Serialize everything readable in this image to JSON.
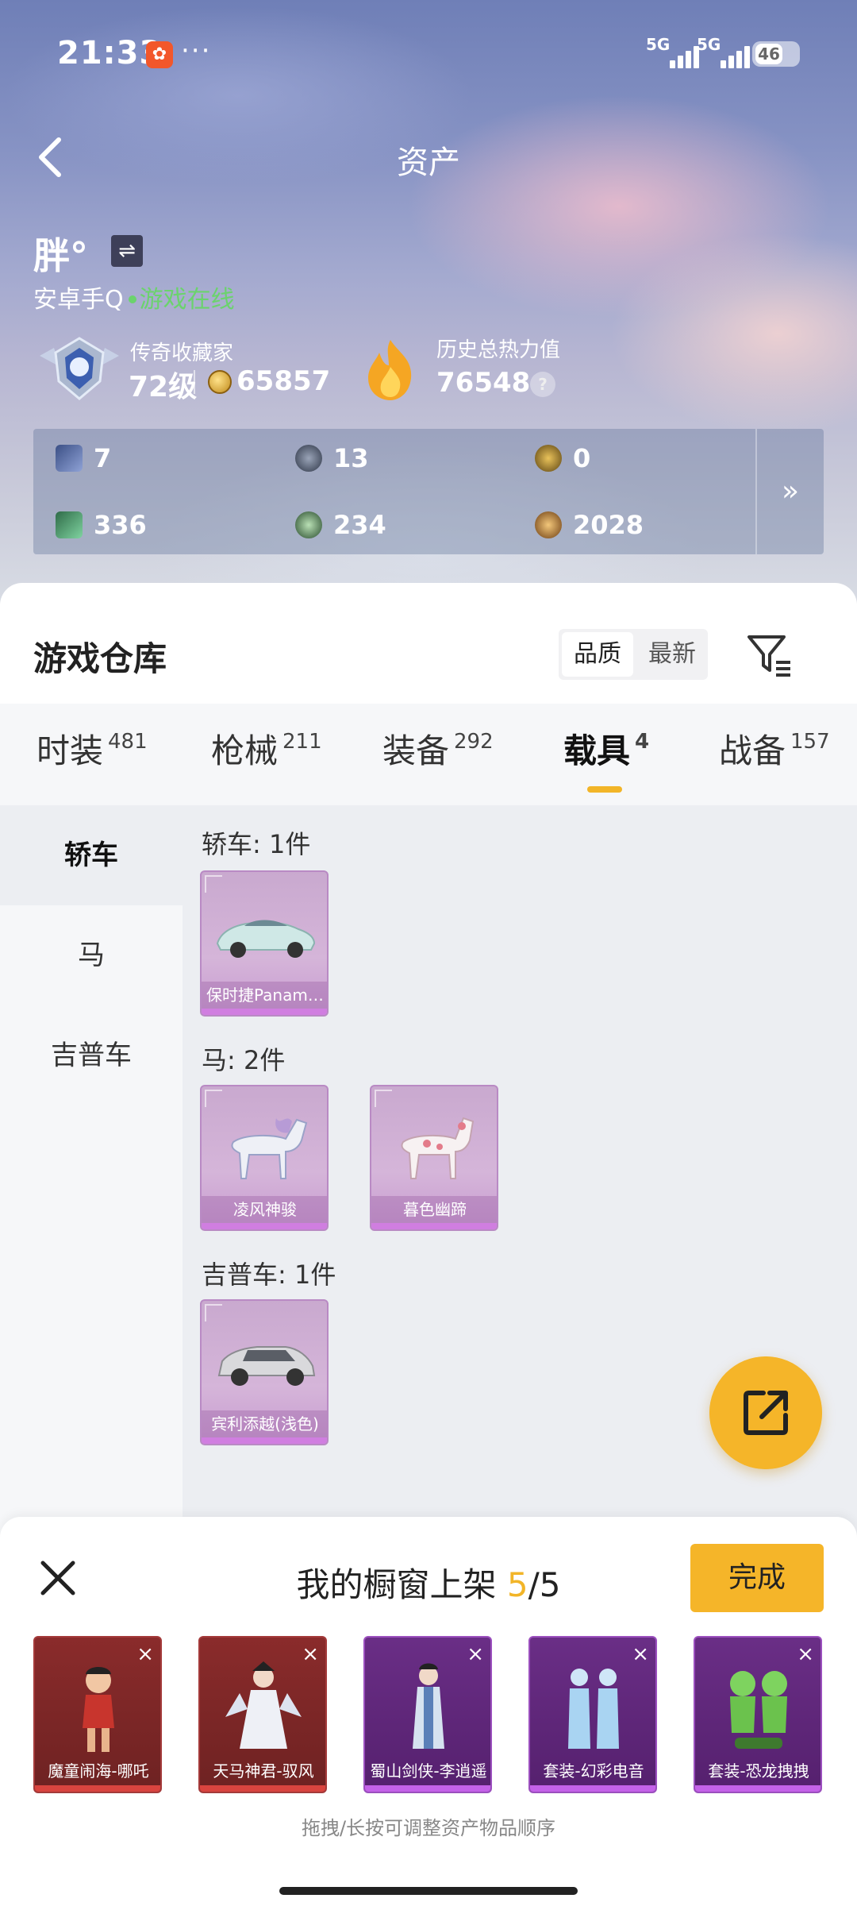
{
  "status_bar": {
    "time": "21:33",
    "more": "···",
    "signal1": "5G",
    "signal2": "5G",
    "battery": "46"
  },
  "nav": {
    "title": "资产"
  },
  "user": {
    "name": "胖°",
    "switch_icon": "⇌",
    "device": "安卓手Q",
    "status": "游戏在线"
  },
  "rank": {
    "label": "传奇收藏家",
    "level": "72级",
    "coins": "65857"
  },
  "heat": {
    "label": "历史总热力值",
    "value": "76548",
    "help": "?"
  },
  "stats": [
    {
      "icon": "card-icon",
      "value": "7"
    },
    {
      "icon": "badge-icon",
      "value": "13"
    },
    {
      "icon": "medal-icon",
      "value": "0"
    },
    {
      "icon": "green-card-icon",
      "value": "336"
    },
    {
      "icon": "orb-icon",
      "value": "234"
    },
    {
      "icon": "gold-orb-icon",
      "value": "2028"
    }
  ],
  "stats_more": "»",
  "warehouse": {
    "title": "游戏仓库",
    "sort_options": [
      "品质",
      "最新"
    ],
    "sort_active": "品质"
  },
  "tabs": [
    {
      "label": "时装",
      "count": "481"
    },
    {
      "label": "枪械",
      "count": "211"
    },
    {
      "label": "装备",
      "count": "292"
    },
    {
      "label": "载具",
      "count": "4"
    },
    {
      "label": "战备",
      "count": "157"
    }
  ],
  "active_tab": "载具",
  "side_nav": [
    "轿车",
    "马",
    "吉普车"
  ],
  "groups": [
    {
      "title": "轿车: 1件",
      "items": [
        "保时捷Panamera"
      ]
    },
    {
      "title": "马: 2件",
      "items": [
        "凌风神骏",
        "暮色幽蹄"
      ]
    },
    {
      "title": "吉普车: 1件",
      "items": [
        "宾利添越(浅色)"
      ]
    }
  ],
  "showcase": {
    "title_prefix": "我的橱窗上架 ",
    "count": "5",
    "total": "/5",
    "done_label": "完成",
    "close_icon": "×",
    "items": [
      {
        "name": "魔童闹海-哪吒",
        "tier": "red"
      },
      {
        "name": "天马神君-驭风",
        "tier": "red"
      },
      {
        "name": "蜀山剑侠-李逍遥",
        "tier": "purple"
      },
      {
        "name": "套装-幻彩电音",
        "tier": "purple"
      },
      {
        "name": "套装-恐龙拽拽",
        "tier": "purple"
      }
    ],
    "hint": "拖拽/长按可调整资产物品顺序"
  },
  "colors": {
    "accent": "#f5b529",
    "online": "#6bd36d",
    "epic": "#c89bd0",
    "legendary": "#8a2b2b"
  }
}
